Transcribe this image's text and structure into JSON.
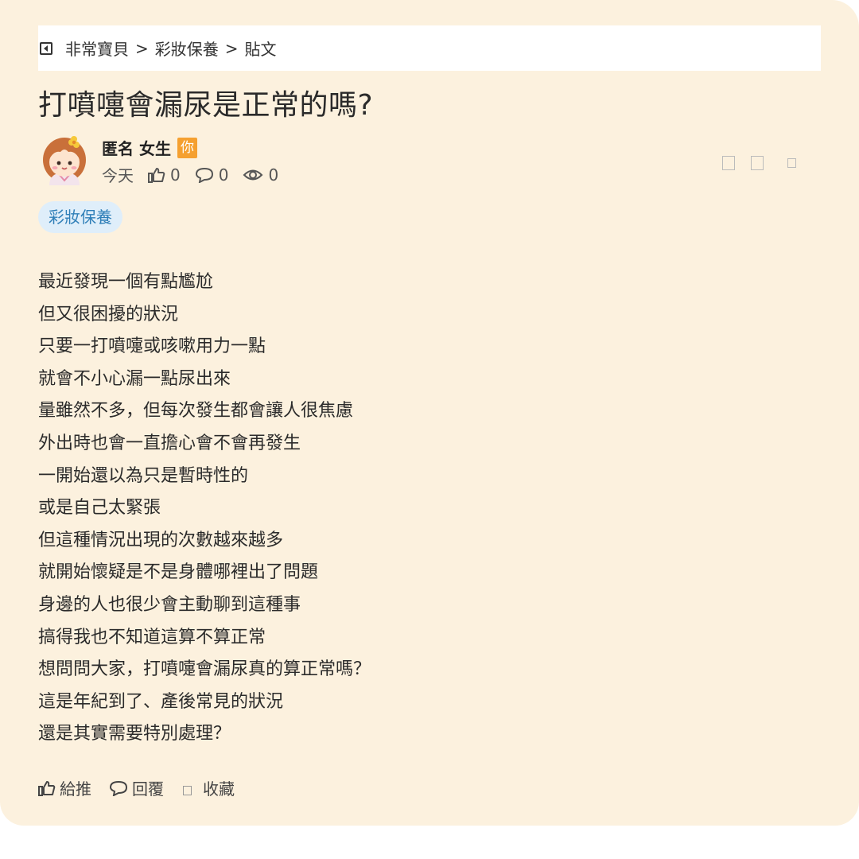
{
  "breadcrumb": {
    "items": [
      "非常寶貝",
      "彩妝保養",
      "貼文"
    ],
    "separator": ">"
  },
  "post": {
    "title": "打噴嚏會漏尿是正常的嗎?",
    "author": {
      "name": "匿名 女生",
      "badge": "你"
    },
    "meta": {
      "date": "今天",
      "likes": "0",
      "comments": "0",
      "views": "0"
    },
    "tag": "彩妝保養",
    "body_lines": [
      "最近發現一個有點尷尬",
      "但又很困擾的狀況",
      "只要一打噴嚏或咳嗽用力一點",
      "就會不小心漏一點尿出來",
      "量雖然不多，但每次發生都會讓人很焦慮",
      "外出時也會一直擔心會不會再發生",
      "一開始還以為只是暫時性的",
      "或是自己太緊張",
      "但這種情況出現的次數越來越多",
      "就開始懷疑是不是身體哪裡出了問題",
      "身邊的人也很少會主動聊到這種事",
      "搞得我也不知道這算不算正常",
      "想問問大家，打噴嚏會漏尿真的算正常嗎？",
      "這是年紀到了、產後常見的狀況",
      "還是其實需要特別處理？"
    ]
  },
  "actions": {
    "like_label": "給推",
    "reply_label": "回覆",
    "save_label": "收藏"
  },
  "colors": {
    "card_bg": "#fcf1de",
    "badge": "#f5a030",
    "tag_bg": "#dfeefa",
    "tag_text": "#2f7fb8"
  }
}
